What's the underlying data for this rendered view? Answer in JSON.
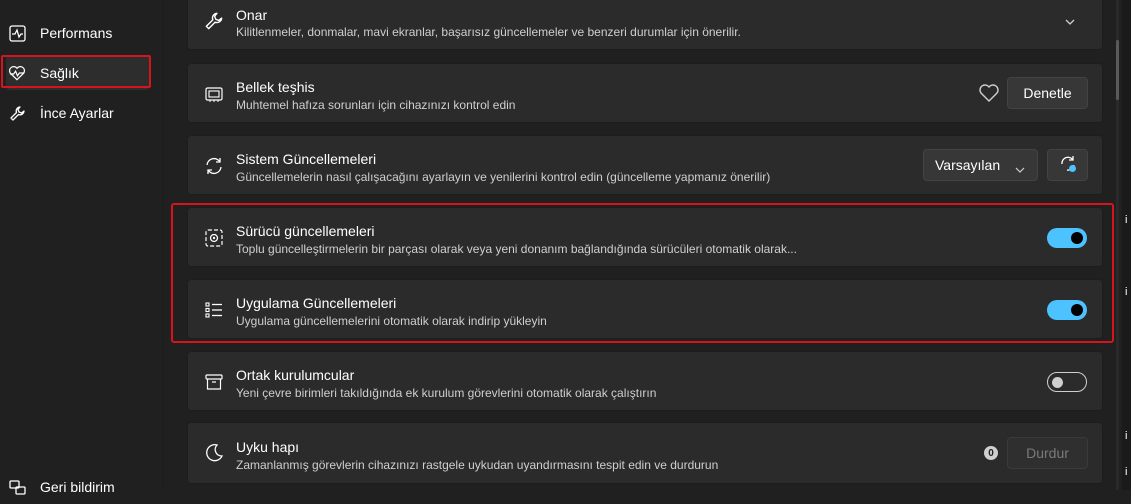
{
  "sidebar": {
    "items": [
      {
        "label": "Performans",
        "icon": "activity-icon"
      },
      {
        "label": "Sağlık",
        "icon": "heart-pulse-icon"
      },
      {
        "label": "İnce Ayarlar",
        "icon": "wrench-icon"
      },
      {
        "label": "Geri bildirim",
        "icon": "feedback-icon"
      }
    ],
    "active": "Sağlık"
  },
  "cards": {
    "onar": {
      "title": "Onar",
      "desc": "Kilitlenmeler, donmalar, mavi ekranlar, başarısız güncellemeler ve benzeri durumlar için önerilir."
    },
    "bellek": {
      "title": "Bellek teşhis",
      "desc": "Muhtemel hafıza sorunları için cihazınızı kontrol edin",
      "button": "Denetle"
    },
    "sistem": {
      "title": "Sistem Güncellemeleri",
      "desc": "Güncellemelerin nasıl çalışacağını ayarlayın ve yenilerini kontrol edin (güncelleme yapmanız önerilir)",
      "dropdown": "Varsayılan"
    },
    "surucu": {
      "title": "Sürücü güncellemeleri",
      "desc": "Toplu güncelleştirmelerin bir parçası olarak veya yeni donanım bağlandığında sürücüleri otomatik olarak...",
      "toggle": "on"
    },
    "uygulama": {
      "title": "Uygulama Güncellemeleri",
      "desc": "Uygulama güncellemelerini otomatik olarak indirip yükleyin",
      "toggle": "on"
    },
    "ortak": {
      "title": "Ortak kurulumcular",
      "desc": "Yeni çevre birimleri takıldığında ek kurulum görevlerini otomatik olarak çalıştırın",
      "toggle": "off"
    },
    "uyku": {
      "title": "Uyku hapı",
      "desc": "Zamanlanmış görevlerin cihazınızı rastgele uykudan uyandırmasını tespit edin ve durdurun",
      "badge": "0",
      "button": "Durdur"
    }
  },
  "colors": {
    "accent": "#4cc2ff",
    "highlight": "#d7141d",
    "card": "#2b2b2b",
    "background": "#202020"
  },
  "edge_fragments": [
    "i",
    "i",
    "i",
    "i"
  ]
}
